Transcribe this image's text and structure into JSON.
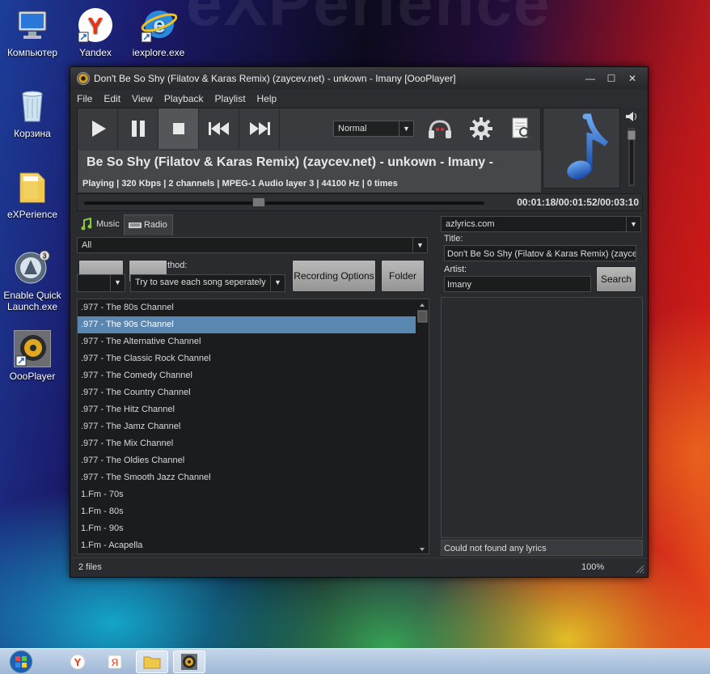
{
  "desktop": {
    "watermark": "eXPerience",
    "icons": [
      {
        "label": "Компьютер",
        "icon": "computer-icon"
      },
      {
        "label": "Yandex",
        "icon": "yandex-icon"
      },
      {
        "label": "iexplore.exe",
        "icon": "ie-icon"
      },
      {
        "label": "Корзина",
        "icon": "recycle-bin-icon"
      },
      {
        "label": "eXPerience",
        "icon": "folder-icon"
      },
      {
        "label": "Enable Quick Launch.exe",
        "icon": "quick-launch-icon"
      },
      {
        "label": "OooPlayer",
        "icon": "oooplayer-icon"
      }
    ]
  },
  "window": {
    "title": "Don't Be So Shy  (Filatov & Karas Remix) (zaycev.net) - unkown - Imany [OooPlayer]",
    "controls": {
      "minimize": "—",
      "maximize": "☐",
      "close": "✕"
    }
  },
  "menu": [
    "File",
    "Edit",
    "View",
    "Playback",
    "Playlist",
    "Help"
  ],
  "player": {
    "mode": "Normal",
    "now_playing": "Be So Shy  (Filatov & Karas Remix) (zaycev.net) - unkown - Imany -",
    "info": "Playing | 320 Kbps | 2 channels | MPEG-1 Audio layer 3 | 44100 Hz | 0 times",
    "time": "00:01:18/00:01:52/00:03:10",
    "progress": 0.42
  },
  "tabs": [
    {
      "label": "Music",
      "icon": "music-icon"
    },
    {
      "label": "Radio",
      "icon": "radio-icon"
    }
  ],
  "radio": {
    "filter": "All",
    "method_label": "thod:",
    "method": "Try to save each song seperately",
    "recording_options": "Recording Options",
    "folder": "Folder",
    "stations": [
      ".977 - The 80s Channel",
      ".977 - The 90s Channel",
      ".977 - The Alternative Channel",
      ".977 - The Classic Rock Channel",
      ".977 - The Comedy Channel",
      ".977 - The Country Channel",
      ".977 - The Hitz Channel",
      ".977 - The Jamz Channel",
      ".977 - The Mix Channel",
      ".977 - The Oldies Channel",
      ".977 - The Smooth Jazz Channel",
      "1.Fm - 70s",
      "1.Fm - 80s",
      "1.Fm - 90s",
      "1.Fm - Acapella"
    ],
    "selected_index": 1
  },
  "lyrics": {
    "source": "azlyrics.com",
    "title_label": "Title:",
    "title_value": "Don't Be So Shy  (Filatov & Karas Remix) (zaycev.net)",
    "artist_label": "Artist:",
    "artist_value": "Imany",
    "search": "Search",
    "status": "Could not found any lyrics"
  },
  "status": {
    "files": "2 files",
    "zoom": "100%"
  },
  "colors": {
    "selection": "#5a87b2",
    "panel": "#2a2b2e"
  }
}
